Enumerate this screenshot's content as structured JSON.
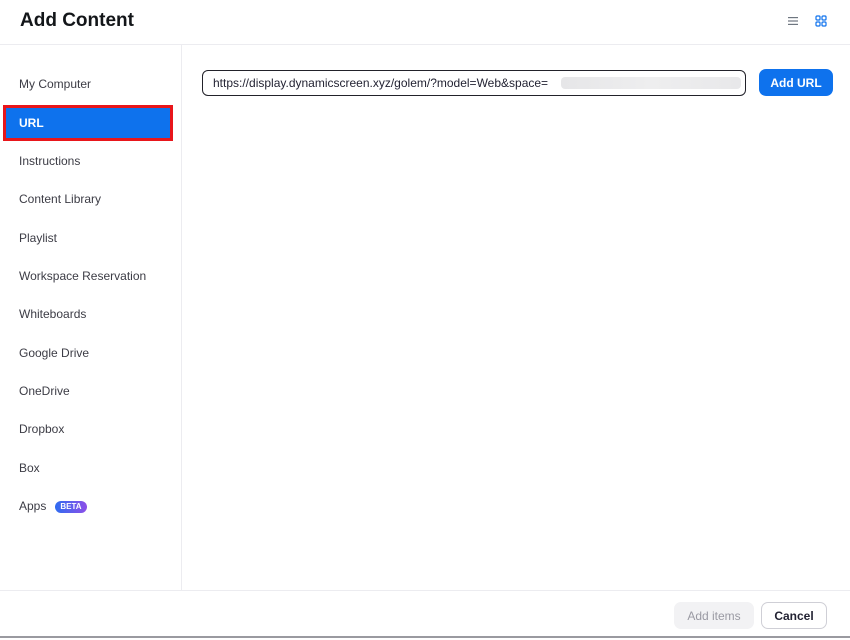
{
  "header": {
    "title": "Add Content",
    "view_icons": [
      "list-view-icon",
      "grid-view-icon"
    ],
    "active_view": "grid"
  },
  "sidebar": {
    "items": [
      {
        "label": "My Computer"
      },
      {
        "label": "URL",
        "active": true
      },
      {
        "label": "Instructions"
      },
      {
        "label": "Content Library"
      },
      {
        "label": "Playlist"
      },
      {
        "label": "Workspace Reservation"
      },
      {
        "label": "Whiteboards"
      },
      {
        "label": "Google Drive"
      },
      {
        "label": "OneDrive"
      },
      {
        "label": "Dropbox"
      },
      {
        "label": "Box"
      },
      {
        "label": "Apps",
        "badge": "BETA"
      }
    ]
  },
  "main": {
    "url_value": "https://display.dynamicscreen.xyz/golem/?model=Web&space=",
    "add_url_label": "Add URL"
  },
  "footer": {
    "add_items_label": "Add items",
    "cancel_label": "Cancel"
  },
  "colors": {
    "accent": "#0e72ed",
    "highlight_outline": "#e8161b"
  }
}
